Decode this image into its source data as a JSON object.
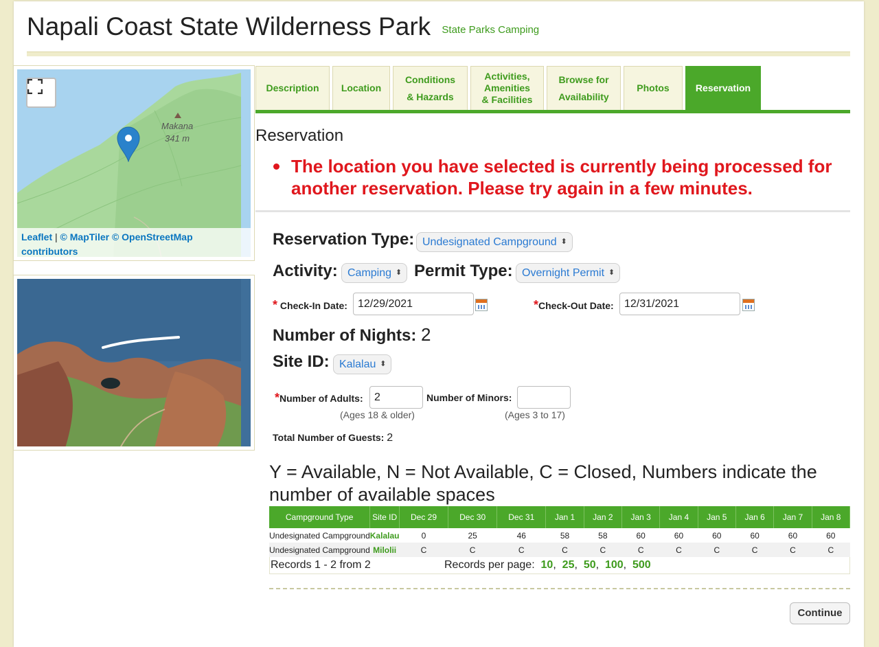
{
  "header": {
    "title": "Napali Coast State Wilderness Park",
    "subtitle": "State Parks Camping"
  },
  "map": {
    "peak_name": "Makana",
    "peak_elevation": "341 m",
    "attribution_leaflet": "Leaflet",
    "attribution_sep": " | ",
    "attribution_maptiler": "© MapTiler © OpenStreetMap",
    "attribution_contributors": "contributors"
  },
  "tabs": [
    {
      "label": "Description"
    },
    {
      "label": "Location"
    },
    {
      "label": "Conditions\n& Hazards"
    },
    {
      "label": "Activities,\nAmenities\n& Facilities"
    },
    {
      "label": "Browse for\nAvailability"
    },
    {
      "label": "Photos"
    },
    {
      "label": "Reservation",
      "active": true
    }
  ],
  "section": {
    "title": "Reservation",
    "error": "The location you have selected is currently being processed for another reservation. Please try again in a few minutes."
  },
  "form": {
    "reservation_type_label": "Reservation Type:",
    "reservation_type_value": "Undesignated Campground",
    "activity_label": "Activity:",
    "activity_value": "Camping",
    "permit_type_label": "Permit Type:",
    "permit_type_value": "Overnight Permit",
    "checkin_label": "Check-In Date:",
    "checkin_value": "12/29/2021",
    "checkout_label": "Check-Out Date:",
    "checkout_value": "12/31/2021",
    "nights_label": "Number of Nights:",
    "nights_value": "2",
    "site_id_label": "Site ID:",
    "site_id_value": "Kalalau",
    "adults_label": "Number of Adults:",
    "adults_value": "2",
    "adults_hint": "(Ages 18 & older)",
    "minors_label": "Number of Minors:",
    "minors_value": "",
    "minors_hint": "(Ages 3 to 17)",
    "total_guests_label": "Total Number of Guests:",
    "total_guests_value": "2"
  },
  "availability": {
    "legend": "Y = Available, N = Not Available, C = Closed, Numbers indicate the number of available spaces",
    "columns": [
      "Campground Type",
      "Site ID",
      "Dec 29",
      "Dec 30",
      "Dec 31",
      "Jan 1",
      "Jan 2",
      "Jan 3",
      "Jan 4",
      "Jan 5",
      "Jan 6",
      "Jan 7",
      "Jan 8"
    ],
    "rows": [
      {
        "type": "Undesignated Campground",
        "site": "Kalalau",
        "values": [
          "0",
          "25",
          "46",
          "58",
          "58",
          "60",
          "60",
          "60",
          "60",
          "60",
          "60"
        ]
      },
      {
        "type": "Undesignated Campground",
        "site": "Milolii",
        "values": [
          "C",
          "C",
          "C",
          "C",
          "C",
          "C",
          "C",
          "C",
          "C",
          "C",
          "C"
        ]
      }
    ],
    "records_text": "Records 1 - 2 from 2",
    "per_page_label": "Records per page:",
    "per_page_options": [
      "10",
      "25",
      "50",
      "100",
      "500"
    ]
  },
  "continue_label": "Continue",
  "colors": {
    "brand_green": "#4ba82a",
    "link_green": "#3e9b1d",
    "error_red": "#e0171d",
    "select_blue": "#2a7ad2"
  }
}
